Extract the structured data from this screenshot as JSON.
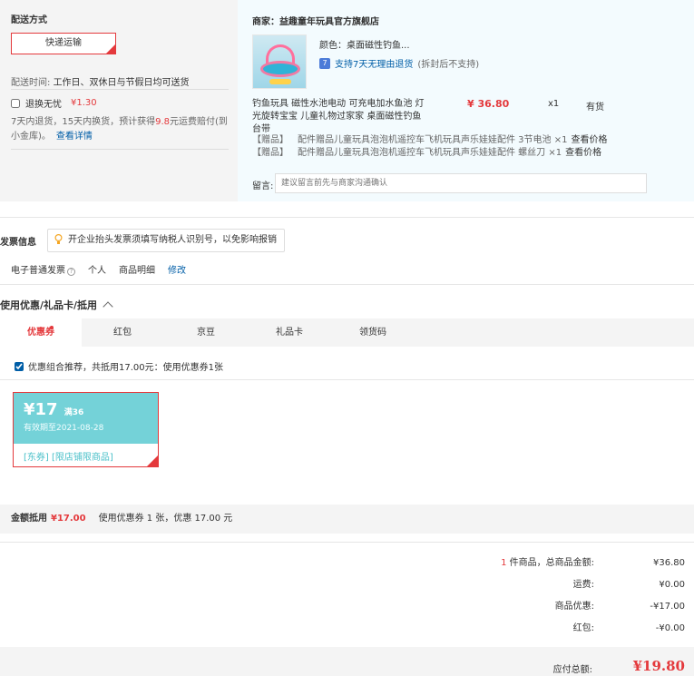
{
  "shipping": {
    "title": "配送方式",
    "option": "快递运输",
    "time_label": "配送时间:",
    "time_value": "工作日、双休日与节假日均可送货",
    "insurance_label": "退换无忧",
    "insurance_price": "¥1.30",
    "insurance_desc_pre": "7天内退货，15天内换货，预计获得",
    "insurance_desc_num": "9.8",
    "insurance_desc_post": "元运费赔付(到小金库)。",
    "insurance_link": "查看详情"
  },
  "shop": {
    "name": "商家：益趣童年玩具官方旗舰店",
    "color_label": "颜色：桌面磁性钓鱼...",
    "support": "支持7天无理由退货",
    "support_sub": "(拆封后不支持)",
    "support_icon": "7",
    "product_name": "钓鱼玩具 磁性水池电动 可充电加水鱼池 灯光旋转宝宝 儿童礼物过家家 桌面磁性钓鱼台带",
    "price": "¥ 36.80",
    "qty": "x1",
    "stock": "有货",
    "gifts": [
      {
        "tag": "【赠品】",
        "text": "配件赠品儿童玩具泡泡机遥控车飞机玩具声乐娃娃配件 3节电池 ×1",
        "link": "查看价格"
      },
      {
        "tag": "【赠品】",
        "text": "配件赠品儿童玩具泡泡机遥控车飞机玩具声乐娃娃配件 螺丝刀 ×1",
        "link": "查看价格"
      }
    ],
    "memo_label": "留言:",
    "memo_placeholder": "建议留言前先与商家沟通确认"
  },
  "invoice": {
    "title": "发票信息",
    "tip": "开企业抬头发票须填写纳税人识别号，以免影响报销",
    "type": "电子普通发票",
    "type_help": "?",
    "holder": "个人",
    "content": "商品明细",
    "edit": "修改"
  },
  "coupon": {
    "title": "使用优惠/礼品卡/抵用",
    "tabs": [
      "优惠券",
      "红包",
      "京豆",
      "礼品卡",
      "领货码"
    ],
    "combo_text": "优惠组合推荐，共抵用17.00元：使用优惠券1张",
    "card": {
      "amount": "¥17",
      "condition": "满36",
      "expiry": "有效期至2021-08-28",
      "scope": "[东券] [限店铺限商品]"
    },
    "summary_label": "金额抵用",
    "summary_amount": "¥17.00",
    "summary_note": "使用优惠券 1 张，优惠 17.00 元"
  },
  "totals": {
    "count": "1",
    "goods_label": " 件商品，总商品金额:",
    "goods_value": "¥36.80",
    "freight_label": "运费:",
    "freight_value": "¥0.00",
    "discount_label": "商品优惠:",
    "discount_value": "-¥17.00",
    "redpacket_label": "红包:",
    "redpacket_value": "-¥0.00",
    "payable_label": "应付总额:",
    "payable_value": "¥19.80"
  },
  "colors": {
    "accent": "#e4393c",
    "link": "#005ea7",
    "coupon": "#74d2d8"
  }
}
